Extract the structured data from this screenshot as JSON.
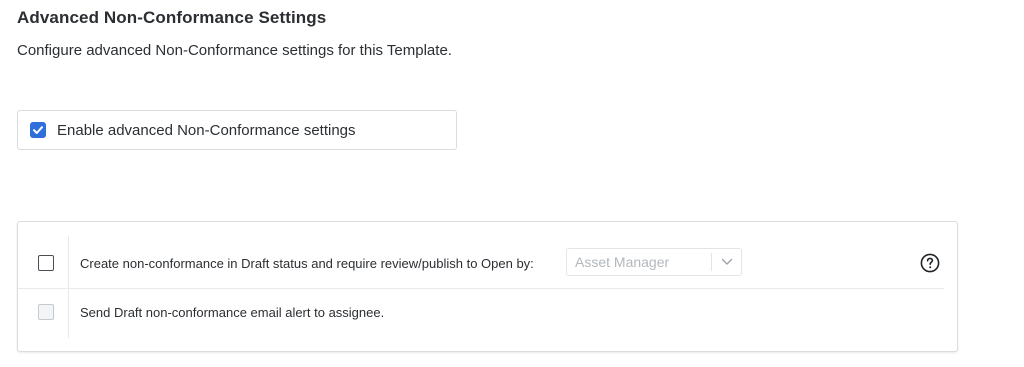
{
  "header": {
    "title": "Advanced Non-Conformance Settings",
    "description": "Configure advanced Non-Conformance settings for this Template."
  },
  "enable_toggle": {
    "label": "Enable advanced Non-Conformance settings",
    "checked": true
  },
  "options": {
    "draft_review": {
      "label": "Create non-conformance in Draft status and require review/publish to Open by:",
      "checked": false,
      "role_select": {
        "value": "Asset Manager",
        "disabled": true
      },
      "help_icon": "help-circle-icon"
    },
    "draft_email": {
      "label": "Send Draft non-conformance email alert to assignee.",
      "checked": false,
      "disabled": true
    }
  },
  "colors": {
    "accent": "#2f6fdc",
    "text": "#2b2f33",
    "border": "#d9dde1",
    "placeholder": "#b3b8bd"
  }
}
